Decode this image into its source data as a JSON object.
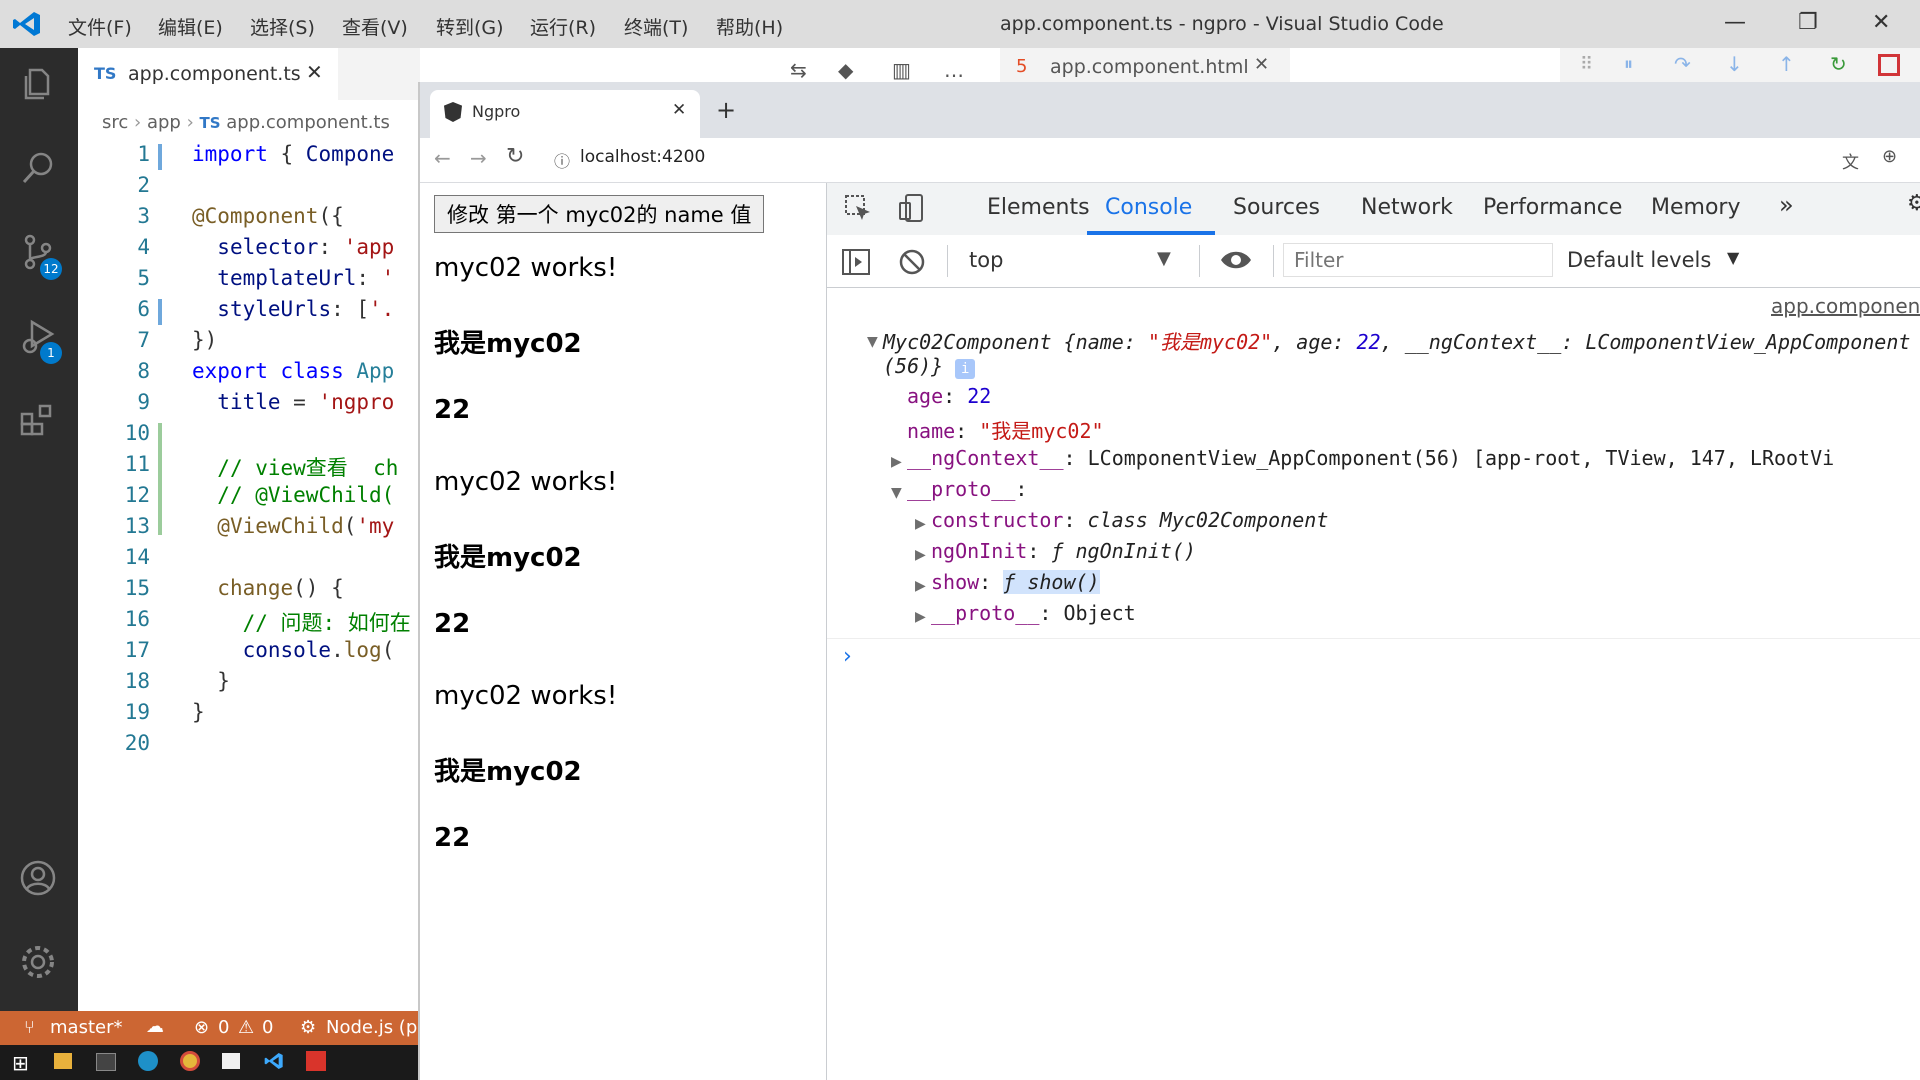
{
  "vscode": {
    "menu": [
      "文件(F)",
      "编辑(E)",
      "选择(S)",
      "查看(V)",
      "转到(G)",
      "运行(R)",
      "终端(T)",
      "帮助(H)"
    ],
    "window_title": "app.component.ts - ngpro - Visual Studio Code",
    "tabs": [
      {
        "badge": "TS",
        "label": "app.component.ts"
      },
      {
        "label": "app.component.html"
      }
    ],
    "breadcrumb": {
      "parts": [
        "src",
        "app"
      ],
      "badge": "TS",
      "file": "app.component.ts"
    },
    "activity_badges": {
      "scm": "12",
      "debug": "1"
    },
    "line_numbers": [
      "1",
      "2",
      "3",
      "4",
      "5",
      "6",
      "7",
      "8",
      "9",
      "10",
      "11",
      "12",
      "13",
      "14",
      "15",
      "16",
      "17",
      "18",
      "19",
      "20"
    ],
    "status": {
      "branch": "master*",
      "errors": "0",
      "warnings": "0",
      "node": "Node.js (p"
    }
  },
  "browser": {
    "tab_title": "Ngpro",
    "url": "localhost:4200",
    "page": {
      "button_label": "修改 第一个 myc02的 name 值",
      "items": [
        {
          "works": "myc02 works!",
          "name": "我是myc02",
          "age": "22"
        },
        {
          "works": "myc02 works!",
          "name": "我是myc02",
          "age": "22"
        },
        {
          "works": "myc02 works!",
          "name": "我是myc02",
          "age": "22"
        }
      ]
    },
    "devtools": {
      "tabs": [
        "Elements",
        "Console",
        "Sources",
        "Network",
        "Performance",
        "Memory"
      ],
      "active_tab": "Console",
      "context": "top",
      "filter_placeholder": "Filter",
      "levels": "Default levels",
      "source_link": "app.component",
      "log": {
        "class_name": "Myc02Component",
        "summary_name": "我是myc02",
        "summary_age": "22",
        "summary_rest": "__ngContext__: LComponentView_AppComponent",
        "count": "(56)}",
        "age_key": "age",
        "age_val": "22",
        "name_key": "name",
        "name_val": "\"我是myc02\"",
        "ngcontext_key": "__ngContext__",
        "ngcontext_val": "LComponentView_AppComponent(56) [app-root, TView, 147, LRootVi",
        "proto_key": "__proto__",
        "constructor_key": "constructor",
        "constructor_val": "class Myc02Component",
        "ngoninit_key": "ngOnInit",
        "ngoninit_val": "ƒ ngOnInit()",
        "show_key": "show",
        "show_val": "ƒ show()",
        "proto2_key": "__proto__",
        "proto2_val": "Object"
      }
    }
  }
}
